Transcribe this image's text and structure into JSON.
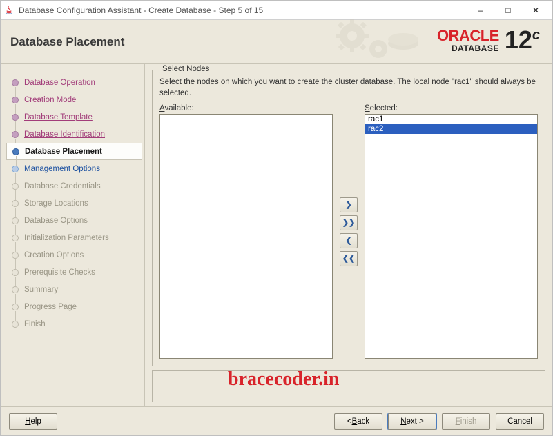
{
  "window": {
    "title": "Database Configuration Assistant - Create Database - Step 5 of 15"
  },
  "header": {
    "page_title": "Database Placement",
    "brand_word": "ORACLE",
    "brand_sub": "DATABASE",
    "brand_ver_num": "12",
    "brand_ver_suffix": "c"
  },
  "sidebar": {
    "steps": [
      {
        "label": "Database Operation",
        "state": "done"
      },
      {
        "label": "Creation Mode",
        "state": "done"
      },
      {
        "label": "Database Template",
        "state": "done"
      },
      {
        "label": "Database Identification",
        "state": "done"
      },
      {
        "label": "Database Placement",
        "state": "current"
      },
      {
        "label": "Management Options",
        "state": "next"
      },
      {
        "label": "Database Credentials",
        "state": "future"
      },
      {
        "label": "Storage Locations",
        "state": "future"
      },
      {
        "label": "Database Options",
        "state": "future"
      },
      {
        "label": "Initialization Parameters",
        "state": "future"
      },
      {
        "label": "Creation Options",
        "state": "future"
      },
      {
        "label": "Prerequisite Checks",
        "state": "future"
      },
      {
        "label": "Summary",
        "state": "future"
      },
      {
        "label": "Progress Page",
        "state": "future"
      },
      {
        "label": "Finish",
        "state": "future"
      }
    ]
  },
  "main": {
    "group_legend": "Select Nodes",
    "instruction": "Select the nodes on which you want to create the cluster database. The local node \"rac1\" should always be selected.",
    "available_label_pre": "A",
    "available_label_rest": "vailable:",
    "selected_label_pre": "S",
    "selected_label_rest": "elected:",
    "available_items": [],
    "selected_items": [
      {
        "label": "rac1",
        "selected": false
      },
      {
        "label": "rac2",
        "selected": true
      }
    ],
    "transfer": {
      "add": "❯",
      "add_all": "❯❯",
      "remove": "❮",
      "remove_all": "❮❮"
    }
  },
  "watermark": "bracecoder.in",
  "footer": {
    "help": "Help",
    "back_mn": "B",
    "back_rest": "ack",
    "next_mn": "N",
    "next_rest": "ext >",
    "finish_mn": "F",
    "finish_rest": "inish",
    "cancel": "Cancel"
  }
}
